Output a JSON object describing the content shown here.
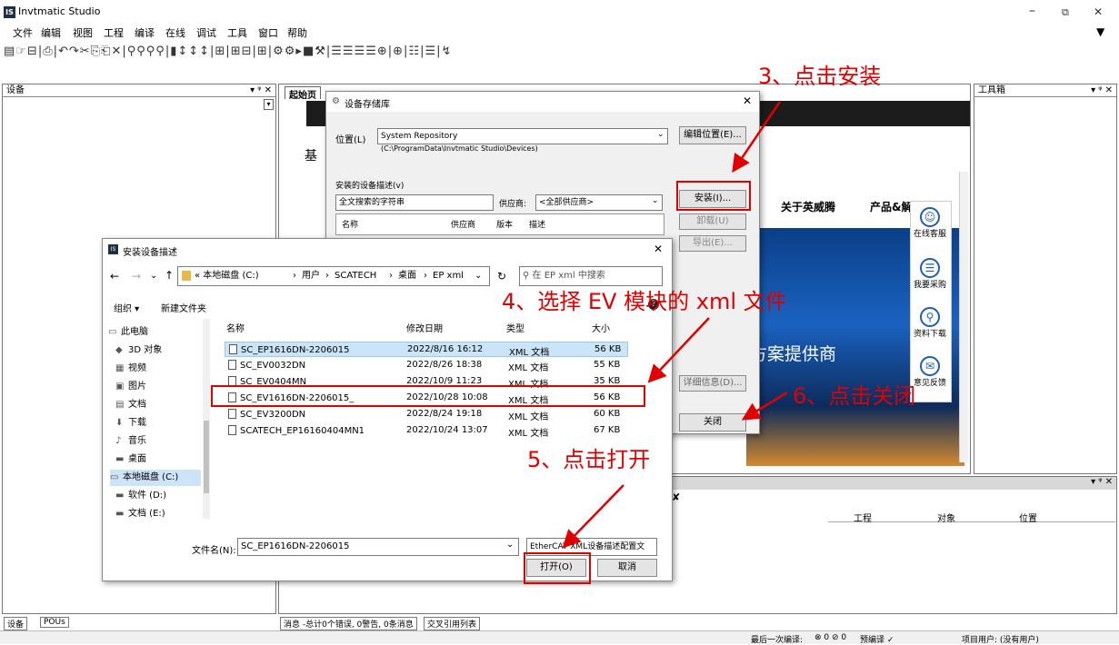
{
  "app": {
    "title": "Invtmatic Studio",
    "logo_text": "IS"
  },
  "window_controls": {
    "minimize": "–",
    "restore": "⧉",
    "close": "✕",
    "pin": "▼"
  },
  "menu": [
    "文件",
    "编辑",
    "视图",
    "工程",
    "编译",
    "在线",
    "调试",
    "工具",
    "窗口",
    "帮助"
  ],
  "toolbar_glyphs": "▤☞⊟|⎙|↶↷✂⎘⎗✕|⚲⚲⚲⚲|▮↕↕↕|⊞|⊞⊟|⊞|⚙⚙▸■⚒|☰☰☰☰⊕|⊕|☷|☰|↯",
  "devices_panel": {
    "title": "设备",
    "pin": "▾ ᵠ ✕"
  },
  "toolbox_panel": {
    "title": "工具箱",
    "pin": "▾ ᵠ ✕"
  },
  "start_tab": {
    "label": "起始页",
    "partial_text": "基"
  },
  "web": {
    "nav_about": "关于英威腾",
    "nav_products": "产品&解决方案",
    "banner": "方案提供商",
    "side": [
      {
        "icon": "☺",
        "label": "在线客服"
      },
      {
        "icon": "☰",
        "label": "我要采购"
      },
      {
        "icon": "⚲",
        "label": "资料下载"
      },
      {
        "icon": "✉",
        "label": "意见反馈"
      }
    ]
  },
  "repo_dialog": {
    "title": "设备存储库",
    "location_label": "位置(L)",
    "location_value": "System Repository",
    "location_path": "(C:\\ProgramData\\Invtmatic Studio\\Devices)",
    "edit_location": "编辑位置(E)...",
    "installed_label": "安装的设备描述(v)",
    "search_placeholder": "全文搜索的字符串",
    "vendor_label": "供应商:",
    "vendor_value": "<全部供应商>",
    "columns": [
      "名称",
      "供应商",
      "版本",
      "描述"
    ],
    "install": "安装(I)...",
    "uninstall": "卸载(U)",
    "export": "导出(E)...",
    "details": "详细信息(D)...",
    "close": "关闭"
  },
  "file_dialog": {
    "title": "安装设备描述",
    "breadcrumb": [
      "« 本地磁盘 (C:)",
      "用户",
      "SCATECH",
      "桌面",
      "EP xml"
    ],
    "search_placeholder": "在 EP xml 中搜索",
    "organize": "组织 ▾",
    "new_folder": "新建文件夹",
    "columns": [
      "名称",
      "修改日期",
      "类型",
      "大小"
    ],
    "nav": [
      {
        "icon": "▭",
        "label": "此电脑"
      },
      {
        "icon": "◆",
        "label": "3D 对象"
      },
      {
        "icon": "▦",
        "label": "视频"
      },
      {
        "icon": "▣",
        "label": "图片"
      },
      {
        "icon": "▤",
        "label": "文档"
      },
      {
        "icon": "⬇",
        "label": "下载"
      },
      {
        "icon": "♪",
        "label": "音乐"
      },
      {
        "icon": "▬",
        "label": "桌面"
      },
      {
        "icon": "▭",
        "label": "本地磁盘 (C:)"
      },
      {
        "icon": "▬",
        "label": "软件 (D:)"
      },
      {
        "icon": "▬",
        "label": "文档 (E:)"
      }
    ],
    "files": [
      {
        "name": "SC_EP1616DN-2206015",
        "date": "2022/8/16 16:12",
        "type": "XML 文档",
        "size": "56 KB"
      },
      {
        "name": "SC_EV0032DN",
        "date": "2022/8/26 18:38",
        "type": "XML 文档",
        "size": "55 KB"
      },
      {
        "name": "SC_EV0404MN",
        "date": "2022/10/9 11:23",
        "type": "XML 文档",
        "size": "35 KB"
      },
      {
        "name": "SC_EV1616DN-2206015_",
        "date": "2022/10/28 10:08",
        "type": "XML 文档",
        "size": "56 KB"
      },
      {
        "name": "SC_EV3200DN",
        "date": "2022/8/24 19:18",
        "type": "XML 文档",
        "size": "60 KB"
      },
      {
        "name": "SCATECH_EP16160404MN1",
        "date": "2022/10/24 13:07",
        "type": "XML 文档",
        "size": "67 KB"
      }
    ],
    "filename_label": "文件名(N):",
    "filename_value": "SC_EP1616DN-2206015",
    "filter_value": "EtherCAT XML设备描述配置文",
    "open": "打开(O)",
    "cancel": "取消"
  },
  "bottom_panel": {
    "columns": [
      "工程",
      "对象",
      "位置"
    ],
    "pin": "▾ ᵠ ✕"
  },
  "bottom_tabs": {
    "devices": "设备",
    "pous": "POUs",
    "messages": "消息 -总计0个错误, 0警告, 0条消息",
    "xref": "交叉引用列表"
  },
  "status": {
    "last_compile": "最后一次编译:",
    "counts": "⊗ 0 ⊘ 0",
    "precompile": "预编译 ✓",
    "project_user": "项目用户: (没有用户)"
  },
  "annotations": {
    "a3": "3、点击安装",
    "a4": "4、选择 EV 模块的 xml 文件",
    "a5": "5、点击打开",
    "a6": "6、点击关闭"
  }
}
